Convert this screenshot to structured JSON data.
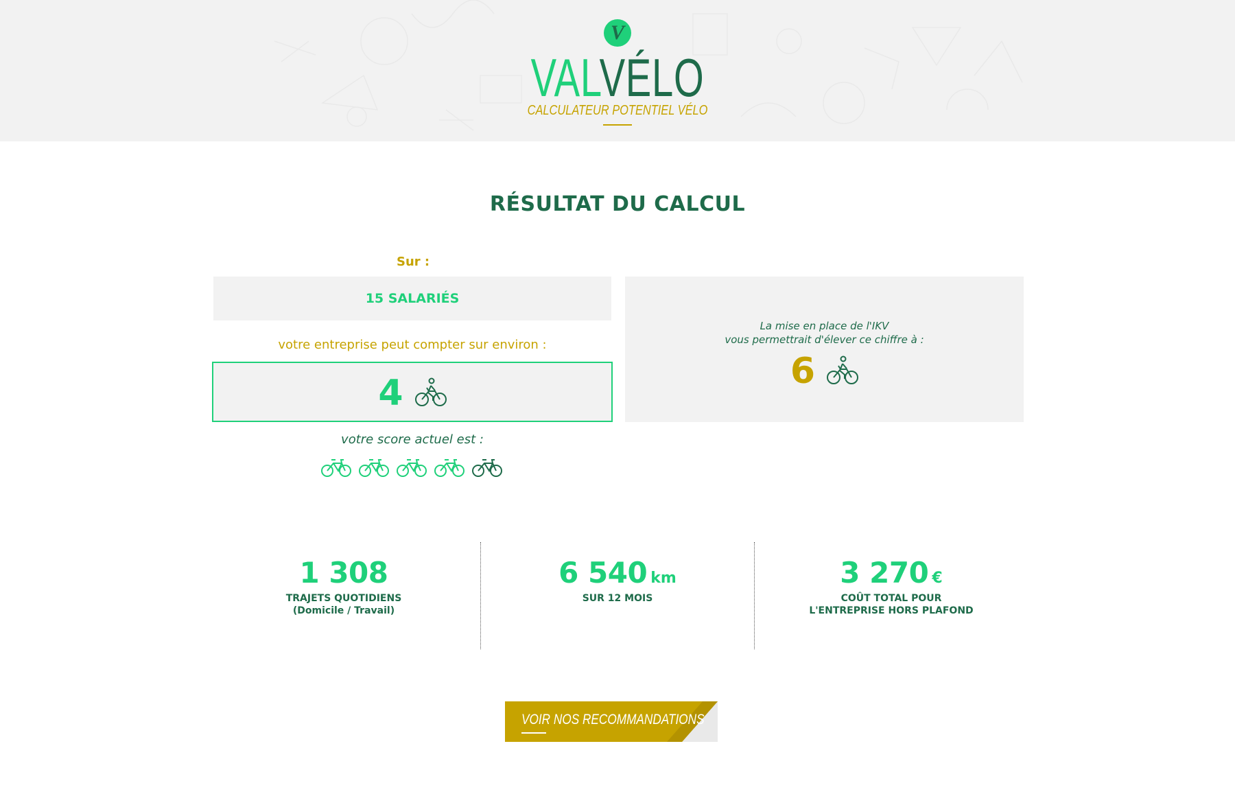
{
  "header": {
    "logo_badge": "V",
    "logo_val": "VAL",
    "logo_velo": "VÉLO",
    "logo_subtitle": "CALCULATEUR POTENTIEL VÉLO"
  },
  "result": {
    "title": "RÉSULTAT DU CALCUL",
    "sur_label": "Sur :",
    "salaries": "15 SALARIÉS",
    "compter_label": "votre entreprise peut compter sur environ :",
    "cyclists_count": "4",
    "score_label": "votre score actuel est :",
    "score_value": 4,
    "score_max": 5,
    "ikv_line1": "La mise en place de l'IKV",
    "ikv_line2": "vous permettrait d'élever ce chiffre à :",
    "ikv_count": "6"
  },
  "stats": [
    {
      "value": "1 308",
      "unit": "",
      "label1": "TRAJETS QUOTIDIENS",
      "label2": "(Domicile / Travail)"
    },
    {
      "value": "6 540",
      "unit": "km",
      "label1": "SUR 12 MOIS",
      "label2": ""
    },
    {
      "value": "3 270",
      "unit": "€",
      "label1": "COÛT TOTAL POUR",
      "label2": "L'ENTREPRISE HORS PLAFOND"
    }
  ],
  "cta": {
    "label": "VOIR NOS RECOMMANDATIONS"
  },
  "colors": {
    "green": "#1fd07a",
    "dark_green": "#1e6b4a",
    "gold": "#c6a300",
    "panel": "#f2f2f2"
  }
}
